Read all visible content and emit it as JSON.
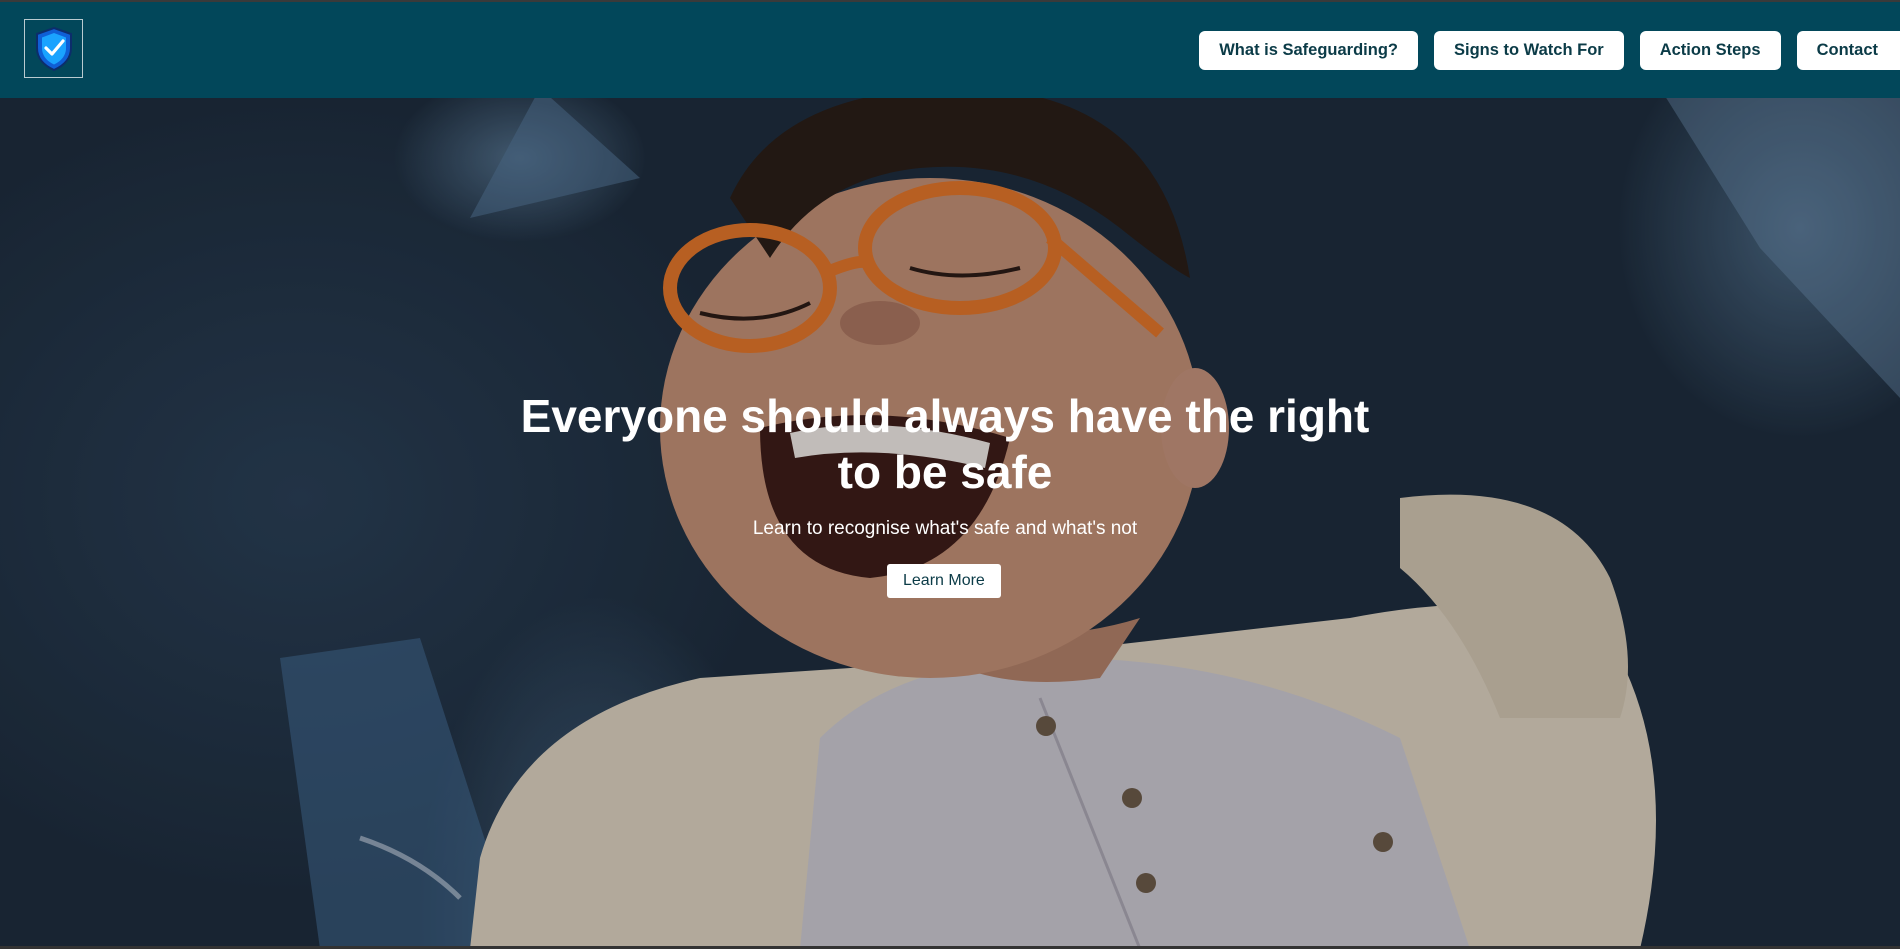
{
  "header": {
    "logo_icon": "shield-check-icon",
    "nav": [
      {
        "label": "What is Safeguarding?"
      },
      {
        "label": "Signs to Watch For"
      },
      {
        "label": "Action Steps"
      },
      {
        "label": "Contact"
      }
    ]
  },
  "hero": {
    "title": "Everyone should always have the right to be safe",
    "subtitle": "Learn to recognise what's safe and what's not",
    "cta_label": "Learn More"
  },
  "colors": {
    "header_bg": "#02475a",
    "button_bg": "#ffffff",
    "button_text": "#0b3b47",
    "accent_orange": "#e0752a"
  }
}
